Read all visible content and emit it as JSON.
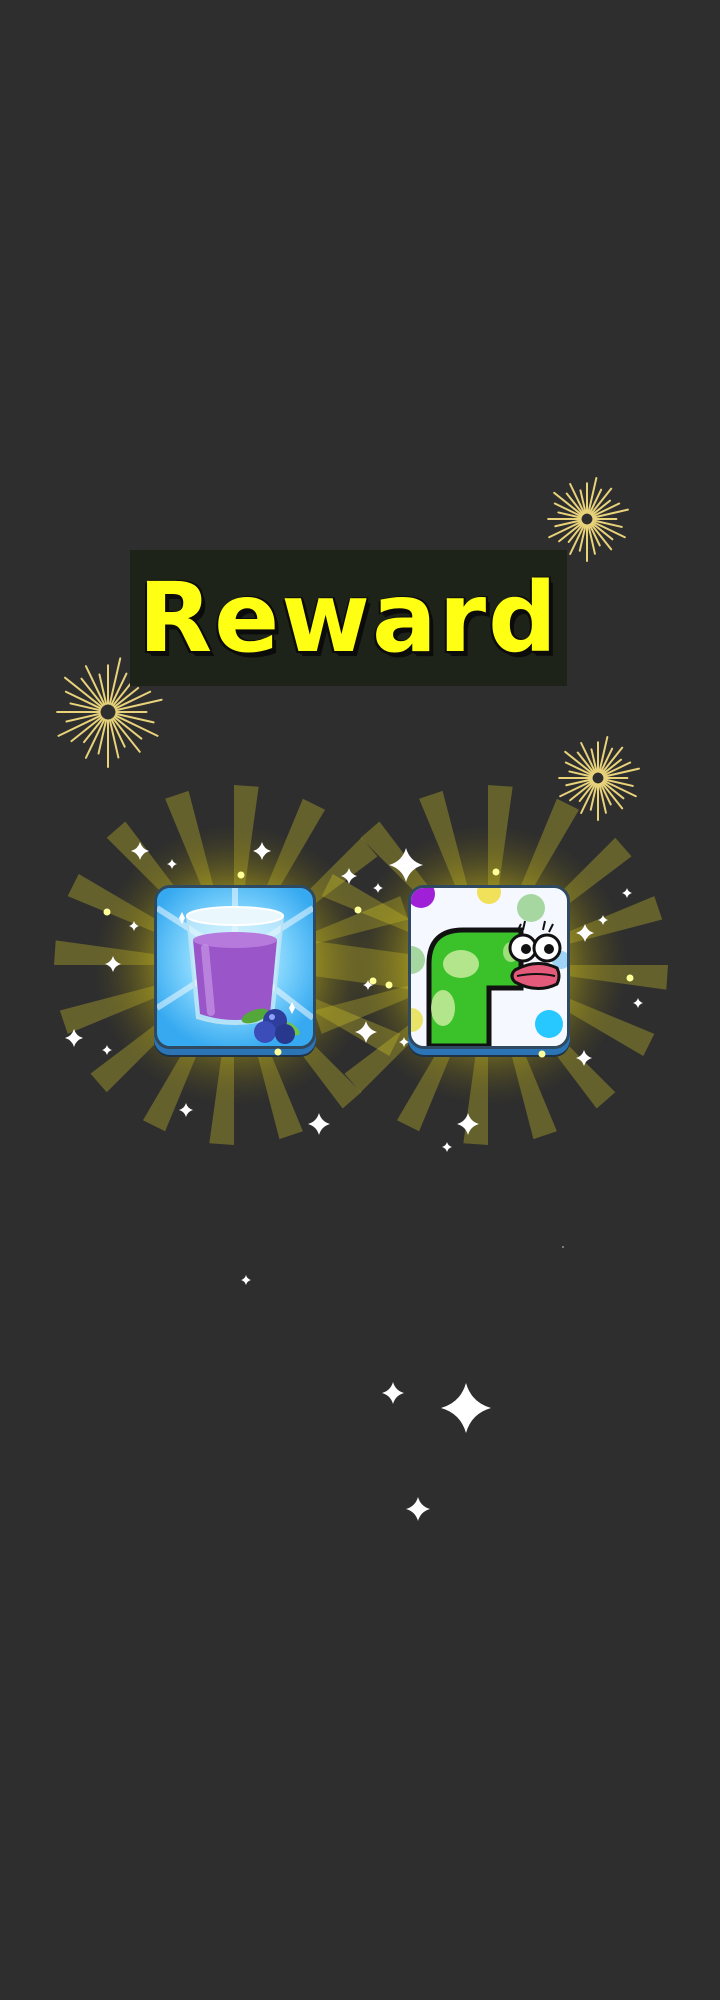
{
  "title": "Reward",
  "rewards": [
    {
      "name": "blueberry-juice",
      "icon": "blueberry-juice-icon",
      "background": "#36a9f0"
    },
    {
      "name": "green-snake-skin",
      "icon": "green-snake-skin-icon",
      "background": "#f6f8ff"
    }
  ],
  "colors": {
    "background": "#2e2e2e",
    "title_text": "#ffff14",
    "title_panel": "#1e2319",
    "glow": "#f4e62a",
    "firework": "#e8d27a"
  }
}
